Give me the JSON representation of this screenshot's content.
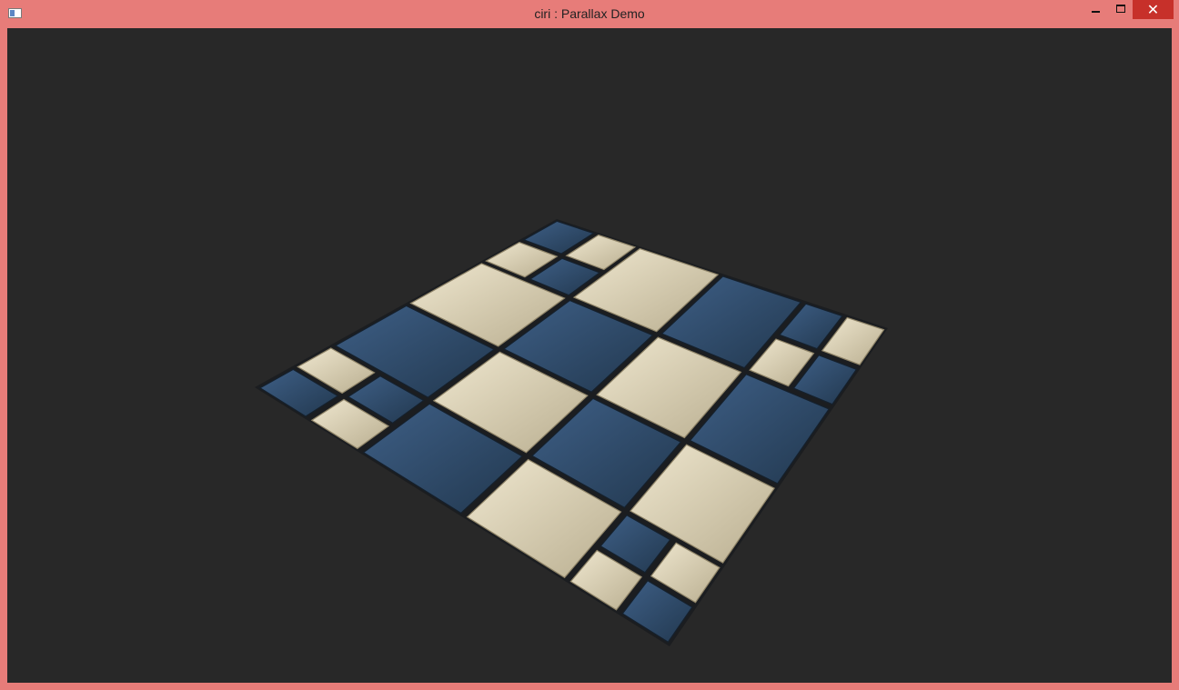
{
  "window": {
    "title": "ciri : Parallax Demo",
    "icons": {
      "app": "window-app-icon",
      "minimize": "minimize-icon",
      "maximize": "maximize-icon",
      "close": "close-icon"
    },
    "colors": {
      "frame": "#e77c79",
      "close_button": "#c7302a",
      "viewport": "#282828"
    }
  },
  "scene": {
    "description_colors": {
      "tile_blue": "#2f4a6b",
      "tile_cream": "#d9d0b6",
      "grout": "#1b1d20"
    }
  }
}
